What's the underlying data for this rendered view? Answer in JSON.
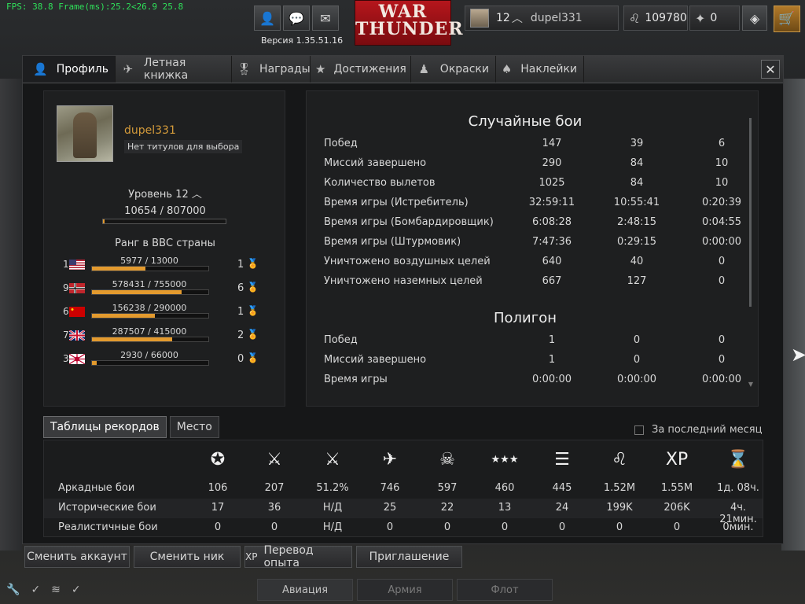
{
  "topbar": {
    "fps": "FPS: 38.8 Frame(ms):25.2<26.9 25.8",
    "version": "Версия 1.35.51.16",
    "logo_line1": "WAR",
    "logo_line2": "THUNDER",
    "level": "12",
    "username": "dupel331",
    "silver": "109780",
    "gold": "0"
  },
  "tabs": [
    {
      "label": "Профиль",
      "icon": "profile-icon"
    },
    {
      "label": "Летная книжка",
      "icon": "logbook-icon"
    },
    {
      "label": "Награды",
      "icon": "medal-icon"
    },
    {
      "label": "Достижения",
      "icon": "achievement-icon"
    },
    {
      "label": "Окраски",
      "icon": "paint-icon"
    },
    {
      "label": "Наклейки",
      "icon": "decal-icon"
    }
  ],
  "profile": {
    "name": "dupel331",
    "title": "Нет титулов для выбора",
    "level_label": "Уровень 12",
    "xp": "10654 / 807000",
    "xp_fraction": 0.013,
    "rank_title": "Ранг в ВВС страны",
    "ranks": [
      {
        "num": "1",
        "country": "usa",
        "value": "5977 / 13000",
        "fraction": 0.46,
        "count": "1"
      },
      {
        "num": "9",
        "country": "germany",
        "value": "578431 / 755000",
        "fraction": 0.77,
        "count": "6"
      },
      {
        "num": "6",
        "country": "ussr",
        "value": "156238 / 290000",
        "fraction": 0.54,
        "count": "1"
      },
      {
        "num": "7",
        "country": "britain",
        "value": "287507 / 415000",
        "fraction": 0.69,
        "count": "2"
      },
      {
        "num": "3",
        "country": "japan",
        "value": "2930 / 66000",
        "fraction": 0.04,
        "count": "0"
      }
    ]
  },
  "stats": {
    "random_title": "Случайные бои",
    "random_rows": [
      {
        "label": "Побед",
        "v": [
          "147",
          "39",
          "6"
        ]
      },
      {
        "label": "Миссий завершено",
        "v": [
          "290",
          "84",
          "10"
        ]
      },
      {
        "label": "Количество вылетов",
        "v": [
          "1025",
          "84",
          "10"
        ]
      },
      {
        "label": "Время игры (Истребитель)",
        "v": [
          "32:59:11",
          "10:55:41",
          "0:20:39"
        ]
      },
      {
        "label": "Время игры (Бомбардировщик)",
        "v": [
          "6:08:28",
          "2:48:15",
          "0:04:55"
        ]
      },
      {
        "label": "Время игры (Штурмовик)",
        "v": [
          "7:47:36",
          "0:29:15",
          "0:00:00"
        ]
      },
      {
        "label": "Уничтожено воздушных целей",
        "v": [
          "640",
          "40",
          "0"
        ]
      },
      {
        "label": "Уничтожено наземных целей",
        "v": [
          "667",
          "127",
          "0"
        ]
      }
    ],
    "poligon_title": "Полигон",
    "poligon_rows": [
      {
        "label": "Побед",
        "v": [
          "1",
          "0",
          "0"
        ]
      },
      {
        "label": "Миссий завершено",
        "v": [
          "1",
          "0",
          "0"
        ]
      },
      {
        "label": "Время игры",
        "v": [
          "0:00:00",
          "0:00:00",
          "0:00:00"
        ]
      }
    ]
  },
  "records": {
    "tab_records": "Таблицы рекордов",
    "tab_place": "Место",
    "last_month": "За последний месяц",
    "icons": [
      "star-rank-icon",
      "crossed-swords-icon",
      "sword-winged-icon",
      "plane-icon",
      "skull-icon",
      "three-stars-icon",
      "ranks-icon",
      "lion-icon",
      "xp-icon",
      "hourglass-icon"
    ],
    "icon_glyphs": [
      "✪",
      "⚔",
      "⚔",
      "✈",
      "☠",
      "★★★",
      "☰",
      "♌",
      "XP",
      "⌛"
    ],
    "rows": [
      {
        "label": "Аркадные бои",
        "v": [
          "106",
          "207",
          "51.2%",
          "746",
          "597",
          "460",
          "445",
          "1.52M",
          "1.55M",
          "1д. 08ч."
        ]
      },
      {
        "label": "Исторические бои",
        "v": [
          "17",
          "36",
          "Н/Д",
          "25",
          "22",
          "13",
          "24",
          "199K",
          "206K",
          "4ч. 21мин."
        ]
      },
      {
        "label": "Реалистичные бои",
        "v": [
          "0",
          "0",
          "Н/Д",
          "0",
          "0",
          "0",
          "0",
          "0",
          "0",
          "0мин."
        ]
      }
    ]
  },
  "footer": {
    "change_account": "Сменить аккаунт",
    "change_nick": "Сменить ник",
    "convert_xp": "Перевод опыта",
    "invite": "Приглашение"
  },
  "bottomnav": [
    "Авиация",
    "Армия",
    "Флот"
  ]
}
